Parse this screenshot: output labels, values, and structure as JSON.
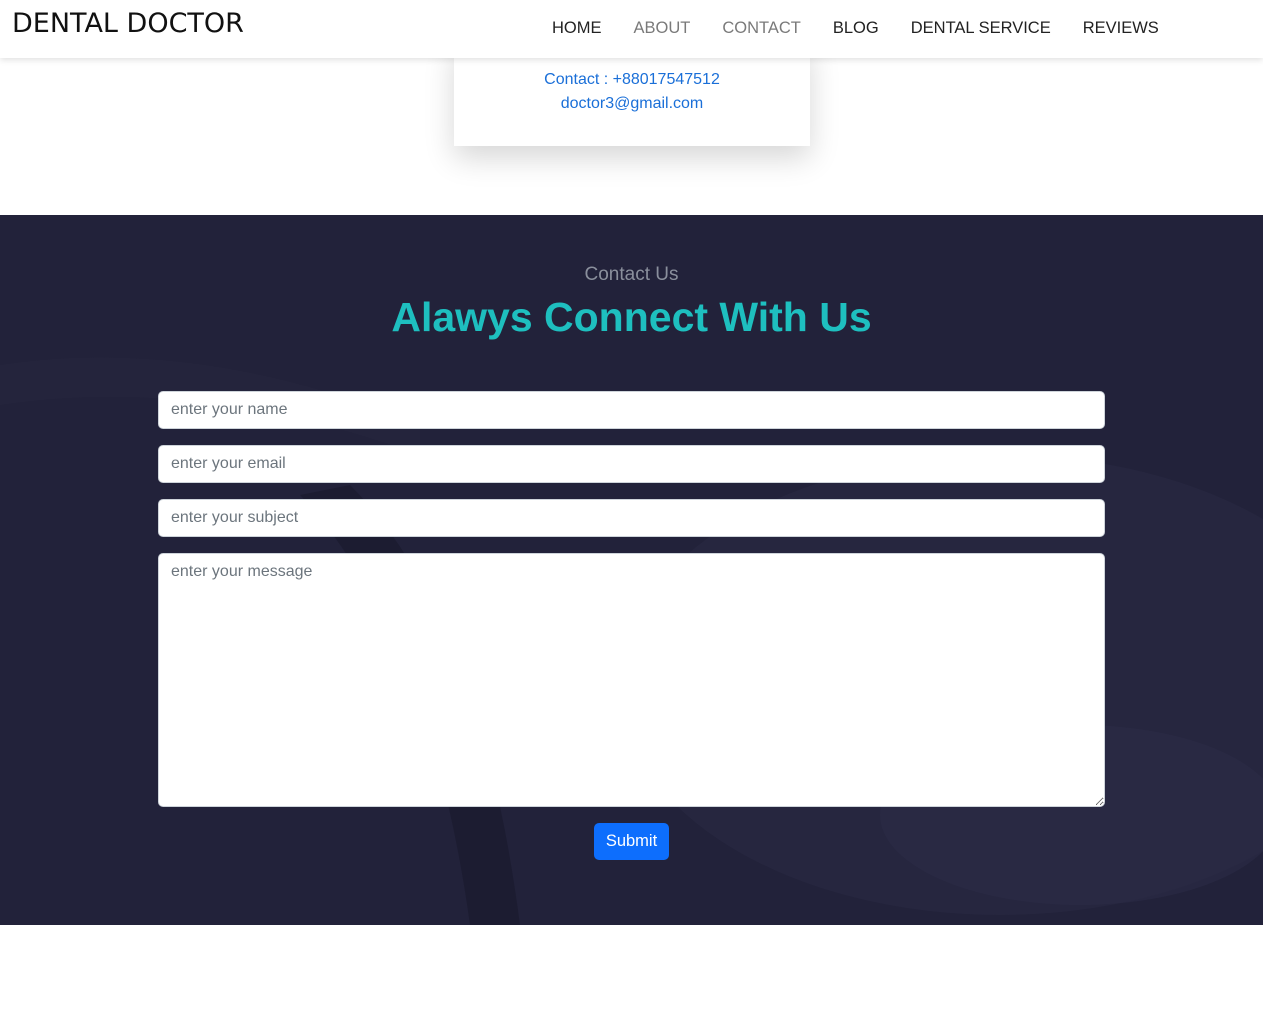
{
  "brand": "DENTAL DOCTOR",
  "nav": [
    {
      "label": "HOME",
      "muted": false
    },
    {
      "label": "ABOUT",
      "muted": true
    },
    {
      "label": "CONTACT",
      "muted": true
    },
    {
      "label": "BLOG",
      "muted": false
    },
    {
      "label": "DENTAL SERVICE",
      "muted": false
    },
    {
      "label": "REVIEWS",
      "muted": false
    }
  ],
  "doctor_card": {
    "contact": "Contact : +88017547512",
    "email": "doctor3@gmail.com"
  },
  "contact_section": {
    "subtitle": "Contact Us",
    "title": "Alawys Connect With Us",
    "name_placeholder": "enter your name",
    "email_placeholder": "enter your email",
    "subject_placeholder": "enter your subject",
    "message_placeholder": "enter your message",
    "submit_label": "Submit"
  },
  "colors": {
    "section_bg": "#22223a",
    "title": "#1ebfbf",
    "link_blue": "#1a6fd8",
    "button": "#0d6efd"
  }
}
